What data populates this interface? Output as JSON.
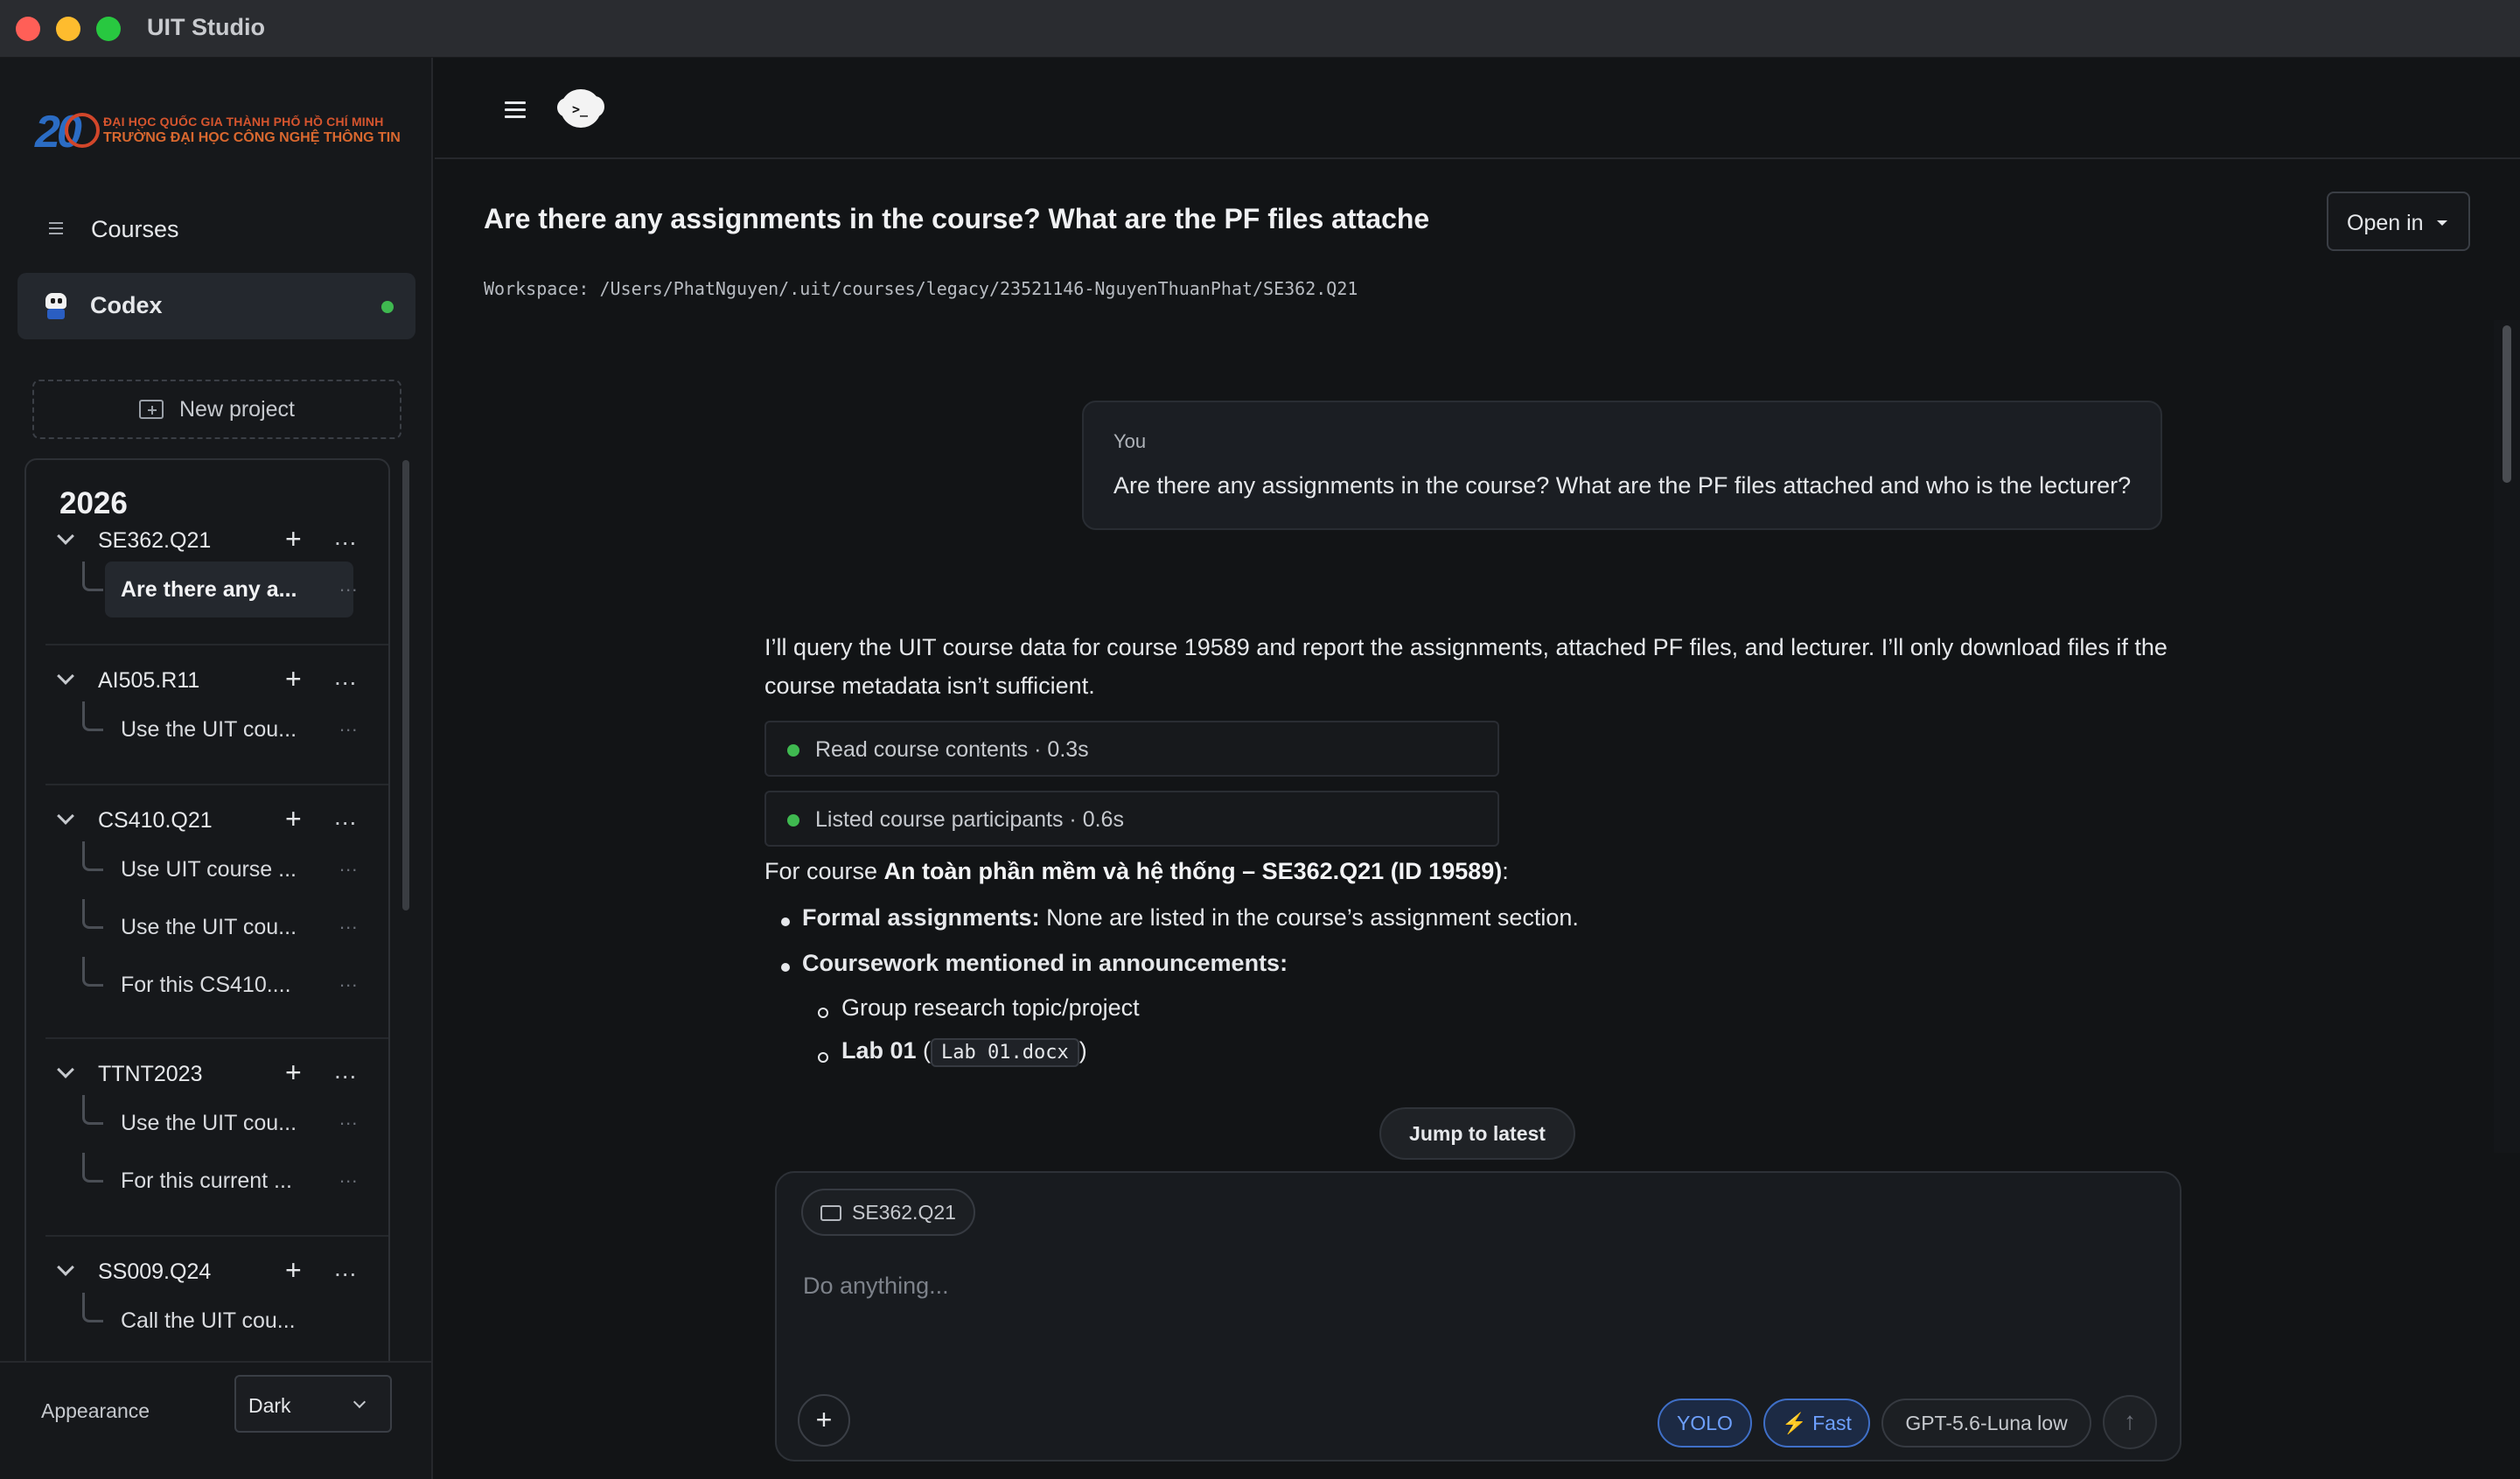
{
  "window": {
    "title": "UIT Studio"
  },
  "sidebar": {
    "logo": {
      "number": "20",
      "line1": "ĐẠI HỌC QUỐC GIA THÀNH PHỐ HỒ CHÍ MINH",
      "line2": "TRƯỜNG ĐẠI HỌC CÔNG NGHỆ THÔNG TIN"
    },
    "nav": [
      {
        "label": "Courses",
        "icon": "menu-icon"
      },
      {
        "label": "Codex",
        "icon": "codex-icon",
        "status": "online",
        "active": true
      }
    ],
    "new_project_label": "New project",
    "year": "2026",
    "groups": [
      {
        "name": "SE362.Q21",
        "threads": [
          "Are there any a..."
        ]
      },
      {
        "name": "AI505.R11",
        "threads": [
          "Use the UIT cou..."
        ]
      },
      {
        "name": "CS410.Q21",
        "threads": [
          "Use UIT course ...",
          "Use the UIT cou...",
          "For this CS410...."
        ]
      },
      {
        "name": "TTNT2023",
        "threads": [
          "Use the UIT cou...",
          "For this current ..."
        ]
      },
      {
        "name": "SS009.Q24",
        "threads": [
          "Call the UIT cou..."
        ]
      }
    ],
    "group_add": "+",
    "group_more": "...",
    "appearance": {
      "label": "Appearance",
      "value": "Dark"
    }
  },
  "main": {
    "conversation_title": "Are there any assignments in the course? What are the PF files attache",
    "workspace": "Workspace: /Users/PhatNguyen/.uit/courses/legacy/23521146-NguyenThuanPhat/SE362.Q21",
    "open_in_label": "Open in",
    "user_message": {
      "author": "You",
      "text": "Are there any assignments in the course? What are the PF files attached and who is the lecturer?"
    },
    "assistant": {
      "intro": "I’ll query the UIT course data for course 19589 and report the assignments, attached PF files, and lecturer. I’ll only download files if the course metadata isn’t sufficient.",
      "tools": [
        {
          "label": "Read course contents · 0.3s",
          "status": "done"
        },
        {
          "label": "Listed course participants · 0.6s",
          "status": "done"
        }
      ],
      "course_prefix": "For course ",
      "course_name": "An toàn phần mềm và hệ thống – SE362.Q21 (ID 19589)",
      "course_suffix": ":",
      "bullets": [
        {
          "label": "Formal assignments:",
          "text": " None are listed in the course’s assignment section."
        },
        {
          "label": "Coursework mentioned in announcements:",
          "text": ""
        }
      ],
      "sub_bullets": [
        {
          "text": "Group research topic/project"
        },
        {
          "label": "Lab 01",
          "pre": " (",
          "code": "Lab 01.docx",
          "post": ")"
        }
      ]
    },
    "jump_label": "Jump to latest",
    "composer": {
      "context_chip": "SE362.Q21",
      "placeholder": "Do anything...",
      "add_label": "+",
      "pills": {
        "yolo": "YOLO",
        "fast": "⚡ Fast",
        "model": "GPT-5.6-Luna low"
      },
      "send_icon": "↑"
    }
  }
}
